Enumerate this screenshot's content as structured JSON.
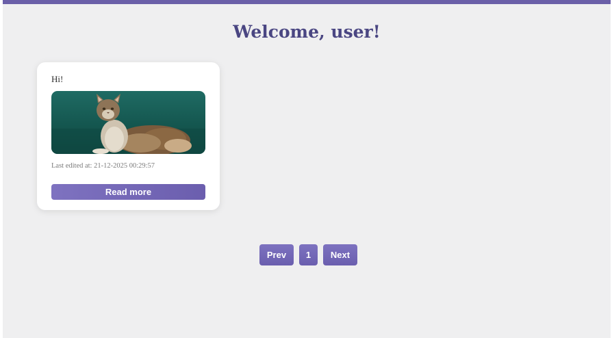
{
  "header": {
    "title": "Welcome, user!"
  },
  "posts": [
    {
      "title": "Hi!",
      "image_icon": "cat-photo",
      "last_edited": "Last edited at: 21-12-2025 00:29:57",
      "read_more_label": "Read more"
    }
  ],
  "pagination": {
    "prev_label": "Prev",
    "current_page": "1",
    "next_label": "Next"
  },
  "colors": {
    "accent": "#6a5fa8",
    "title": "#4a4682",
    "background": "#efeff0"
  }
}
